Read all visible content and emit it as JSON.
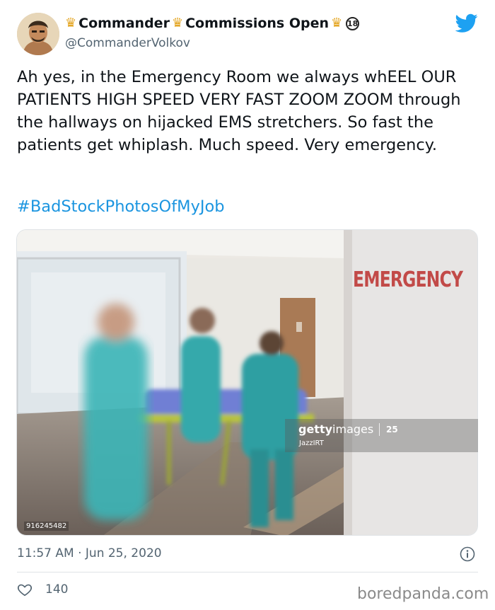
{
  "tweet": {
    "display_name_parts": [
      "Commander",
      "Commissions Open"
    ],
    "age_badge": "18",
    "handle": "@CommanderVolkov",
    "text": "Ah yes, in the Emergency Room we always whEEL OUR PATIENTS HIGH SPEED VERY FAST ZOOM ZOOM through the hallways on hijacked EMS stretchers. So fast the patients get whiplash. Much speed. Very emergency.",
    "hashtag": "#BadStockPhotosOfMyJob",
    "timestamp": "11:57 AM · Jun 25, 2020",
    "like_count": "140"
  },
  "photo": {
    "sign_text": "EMERGENCY",
    "getty_brand_bold": "getty",
    "getty_brand_light": "images",
    "getty_years": "25",
    "getty_credit": "JazzIRT",
    "photo_id": "916245482"
  },
  "watermark": "boredpanda.com",
  "icons": {
    "logo": "twitter-bird-icon",
    "crown": "crown-icon",
    "info": "info-icon",
    "like": "heart-icon"
  },
  "colors": {
    "link": "#1b95e0",
    "twitter_blue": "#1da1f2",
    "muted": "#536471",
    "crown": "#e3a21a",
    "sign_red": "#c24a48"
  }
}
